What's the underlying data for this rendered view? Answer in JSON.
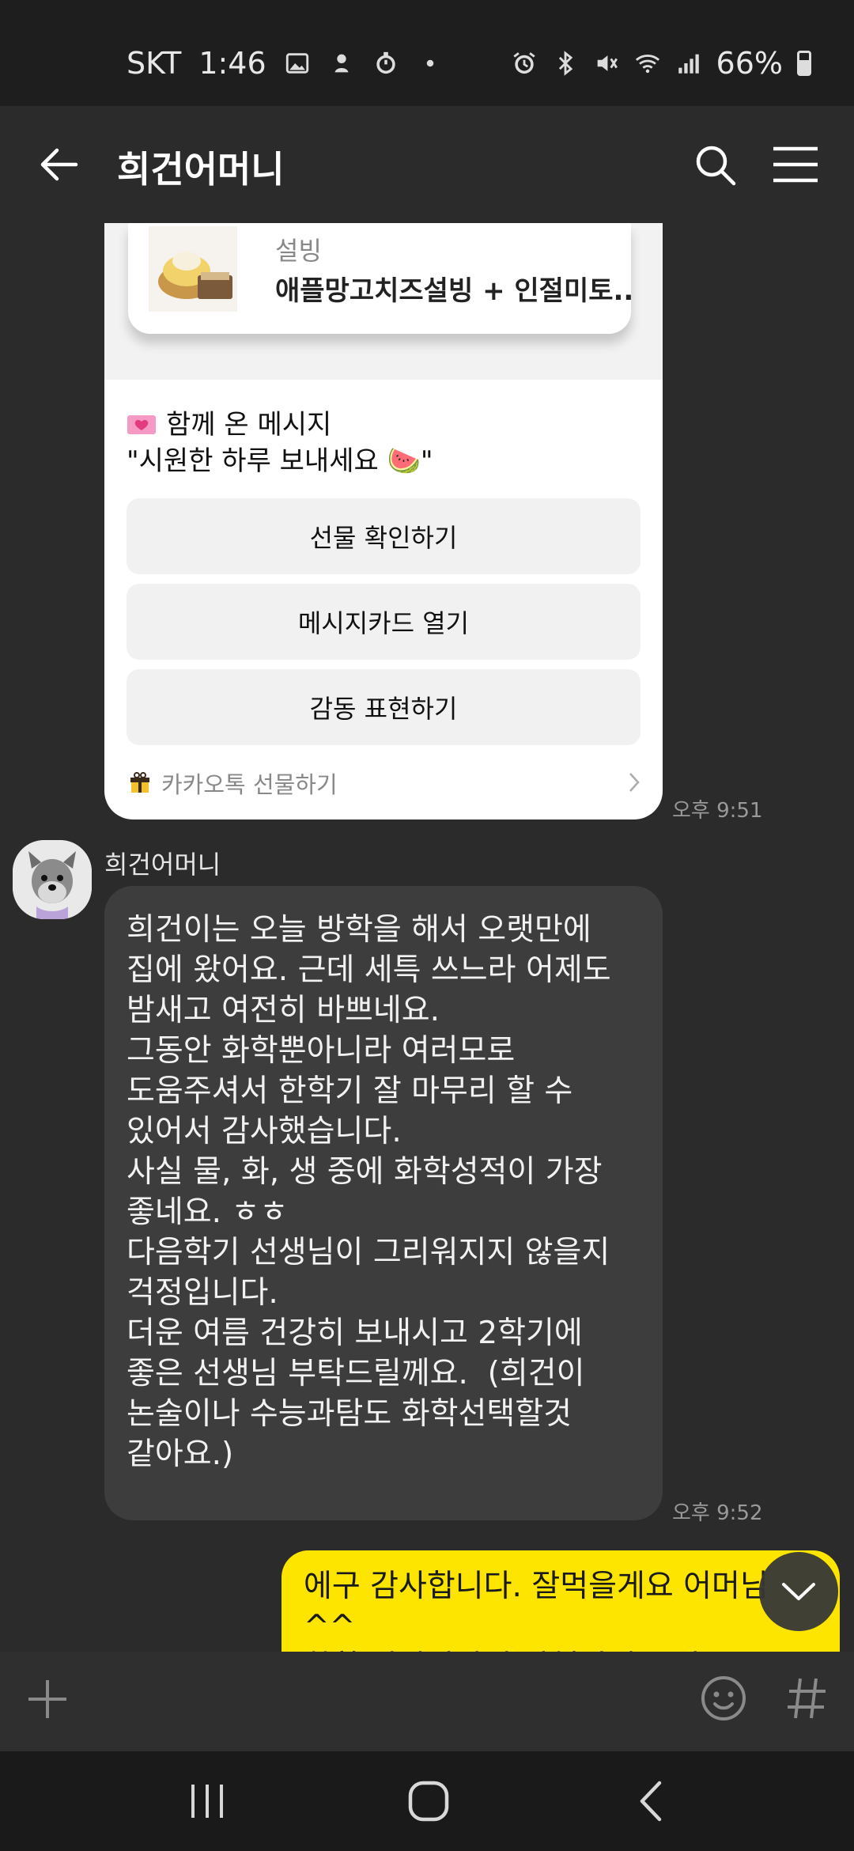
{
  "status_bar": {
    "carrier": "SKT",
    "time": "1:46",
    "battery": "66%"
  },
  "header": {
    "title": "희건어머니"
  },
  "gift_card": {
    "product_brand": "설빙",
    "product_name": "애플망고치즈설빙 + 인절미토..",
    "message_label": "함께 온 메시지",
    "message_text": "\"시원한 하루 보내세요 🍉\"",
    "buttons": [
      "선물 확인하기",
      "메시지카드 열기",
      "감동 표현하기"
    ],
    "footer_label": "카카오톡 선물하기",
    "time": "오후 9:51"
  },
  "received_message": {
    "sender": "희건어머니",
    "text": "희건이는 오늘 방학을 해서 오랫만에\n집에 왔어요. 근데 세특 쓰느라 어제도\n밤새고 여전히 바쁘네요.\n그동안 화학뿐아니라 여러모로\n도움주셔서 한학기 잘 마무리 할 수\n있어서 감사했습니다.\n사실 물, 화, 생 중에 화학성적이 가장\n좋네요. ㅎㅎ\n다음학기 선생님이 그리워지지 않을지\n걱정입니다.\n더운 여름 건강히 보내시고 2학기에\n좋은 선생님 부탁드릴께요.  (희건이\n논술이나 수능과탐도 화학선택할것\n같아요.)",
    "time": "오후 9:52"
  },
  "sent_message": {
    "text": "에구 감사합니다. 잘먹을게요 어머님^^\n화학 잘나왔다니 다행이네요 다른"
  },
  "icons": {
    "back": "arrow-left-icon",
    "search": "search-icon",
    "menu": "hamburger-icon",
    "attach": "plus-icon",
    "emoji": "emoji-icon",
    "hashtag": "hash-icon",
    "scroll_down": "chevron-down-icon"
  },
  "colors": {
    "sent_bubble": "#fee500",
    "received_bubble": "#3d3d3d",
    "background": "#2b2b2b"
  }
}
